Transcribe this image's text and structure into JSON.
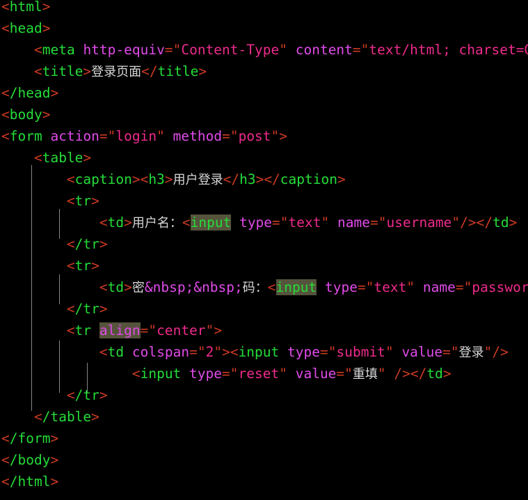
{
  "editor": {
    "background_color": "#000000",
    "highlight_color": "#56533c",
    "guide_color": "#a0a0a0",
    "colors": {
      "bracket": "#cc3a22",
      "tag_name": "#25dd38",
      "attribute": "#e14bea",
      "value": "#ee2b8c",
      "text": "#d8d8d8",
      "entity": "#e14bea"
    },
    "language": "html",
    "line_count": 21
  },
  "lines": [
    {
      "n": 1,
      "indent": 0,
      "text": "<html>"
    },
    {
      "n": 2,
      "indent": 0,
      "text": "<head>"
    },
    {
      "n": 3,
      "indent": 1,
      "text": "<meta http-equiv=\"Content-Type\" content=\"text/html; charset=GBK\" />"
    },
    {
      "n": 4,
      "indent": 1,
      "text": "<title>登录页面</title>"
    },
    {
      "n": 5,
      "indent": 0,
      "text": "</head>"
    },
    {
      "n": 6,
      "indent": 0,
      "text": "<body>"
    },
    {
      "n": 7,
      "indent": 0,
      "text": "<form action=\"login\" method=\"post\">"
    },
    {
      "n": 8,
      "indent": 1,
      "text": "<table>"
    },
    {
      "n": 9,
      "indent": 2,
      "text": "<caption><h3>用户登录</h3></caption>"
    },
    {
      "n": 10,
      "indent": 2,
      "text": "<tr>"
    },
    {
      "n": 11,
      "indent": 3,
      "text": "<td>用户名：<input type=\"text\" name=\"username\"/></td>"
    },
    {
      "n": 12,
      "indent": 2,
      "text": "</tr>"
    },
    {
      "n": 13,
      "indent": 2,
      "text": "<tr>"
    },
    {
      "n": 14,
      "indent": 3,
      "text": "<td>密&nbsp;&nbsp;码：<input type=\"text\" name=\"password\"/></td>"
    },
    {
      "n": 15,
      "indent": 2,
      "text": "</tr>"
    },
    {
      "n": 16,
      "indent": 2,
      "text": "<tr align=\"center\">"
    },
    {
      "n": 17,
      "indent": 3,
      "text": "<td colspan=\"2\"><input type=\"submit\" value=\"登录\"/>"
    },
    {
      "n": 18,
      "indent": 4,
      "text": "<input type=\"reset\" value=\"重填\" /></td>"
    },
    {
      "n": 19,
      "indent": 2,
      "text": "</tr>"
    },
    {
      "n": 20,
      "indent": 1,
      "text": "</table>"
    },
    {
      "n": 21,
      "indent": 0,
      "text": "</form>"
    },
    {
      "n": 22,
      "indent": 0,
      "text": "</body>"
    },
    {
      "n": 23,
      "indent": 0,
      "text": "</html>"
    }
  ],
  "tokens": {
    "l1": {
      "tag": "html"
    },
    "l2": {
      "tag": "head"
    },
    "l3": {
      "tag": "meta",
      "attr1": "http-equiv",
      "val1": "Content-Type",
      "attr2": "content",
      "val2": "text/html; charset=GBK"
    },
    "l4": {
      "tag": "title",
      "content": "登录页面"
    },
    "l5": {
      "tag": "/head"
    },
    "l6": {
      "tag": "body"
    },
    "l7": {
      "tag": "form",
      "attr1": "action",
      "val1": "login",
      "attr2": "method",
      "val2": "post"
    },
    "l8": {
      "tag": "table"
    },
    "l9": {
      "tag": "caption",
      "tag2": "h3",
      "content": "用户登录"
    },
    "l10": {
      "tag": "tr"
    },
    "l11": {
      "tag": "td",
      "label": "用户名：",
      "tag2": "input",
      "attr1": "type",
      "val1": "text",
      "attr2": "name",
      "val2": "username"
    },
    "l12": {
      "tag": "/tr"
    },
    "l13": {
      "tag": "tr"
    },
    "l14": {
      "tag": "td",
      "label_a": "密",
      "entity1": "&nbsp;",
      "entity2": "&nbsp;",
      "label_b": "码：",
      "tag2": "input",
      "attr1": "type",
      "val1": "text",
      "attr2": "name",
      "val2": "password"
    },
    "l15": {
      "tag": "/tr"
    },
    "l16": {
      "tag": "tr",
      "attr1": "align",
      "val1": "center"
    },
    "l17": {
      "tag": "td",
      "attr1": "colspan",
      "val1": "2",
      "tag2": "input",
      "attr2": "type",
      "val2": "submit",
      "attr3": "value",
      "val3": "登录"
    },
    "l18": {
      "tag": "input",
      "attr1": "type",
      "val1": "reset",
      "attr2": "value",
      "val2": "重填",
      "tag2": "/td"
    },
    "l19": {
      "tag": "/tr"
    },
    "l20": {
      "tag": "/table"
    },
    "l21": {
      "tag": "/form"
    },
    "l22": {
      "tag": "/body"
    },
    "l23": {
      "tag": "/html"
    }
  },
  "highlights": [
    {
      "token": "input",
      "line": 11,
      "reason": "bracket-match"
    },
    {
      "token": "input",
      "line": 14,
      "reason": "bracket-match"
    },
    {
      "token": "align",
      "line": 16,
      "reason": "bracket-match"
    }
  ]
}
